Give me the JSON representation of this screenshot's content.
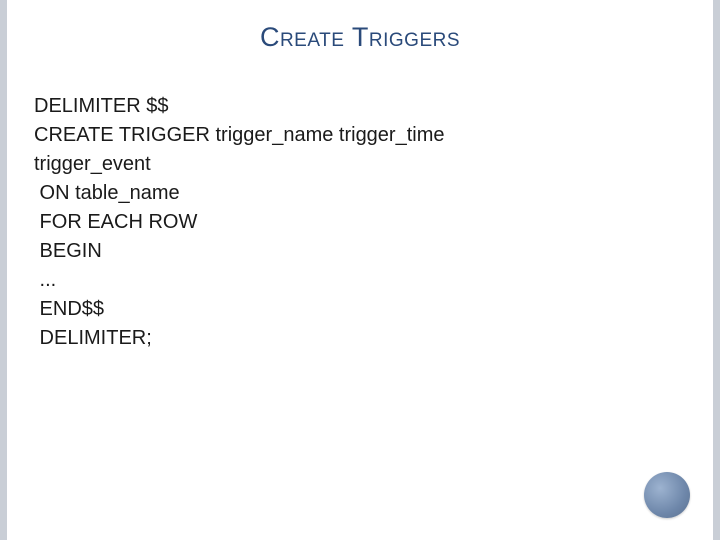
{
  "title": "Create Triggers",
  "code": {
    "l1": "DELIMITER $$",
    "l2": "CREATE TRIGGER trigger_name trigger_time",
    "l3": "trigger_event",
    "l4": " ON table_name",
    "l5": " FOR EACH ROW",
    "l6": " BEGIN",
    "l7": " ...",
    "l8": " END$$",
    "l9": " DELIMITER;"
  }
}
